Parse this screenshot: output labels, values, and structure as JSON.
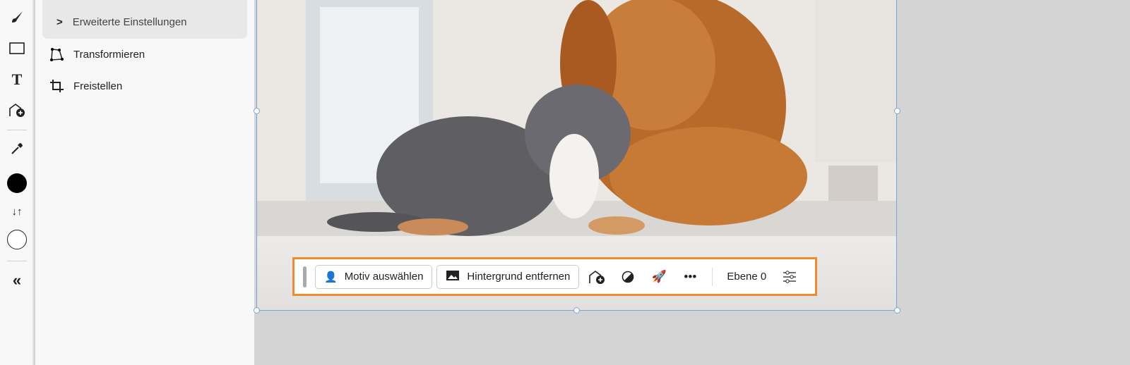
{
  "toolbar": {
    "tools": [
      "brush-icon",
      "rectangle-icon",
      "text-icon",
      "add-image-icon",
      "eyedropper-icon",
      "foreground-color",
      "swap-colors-icon",
      "background-color",
      "collapse-icon"
    ],
    "foreground_color": "#000000",
    "background_color": "#ffffff"
  },
  "panel": {
    "advanced_settings": "Erweiterte Einstellungen",
    "transform": "Transformieren",
    "crop": "Freistellen"
  },
  "context_bar": {
    "select_subject": "Motiv auswählen",
    "remove_background": "Hintergrund entfernen",
    "layer_name": "Ebene 0",
    "more": "•••",
    "accent": "#f08a2c"
  }
}
